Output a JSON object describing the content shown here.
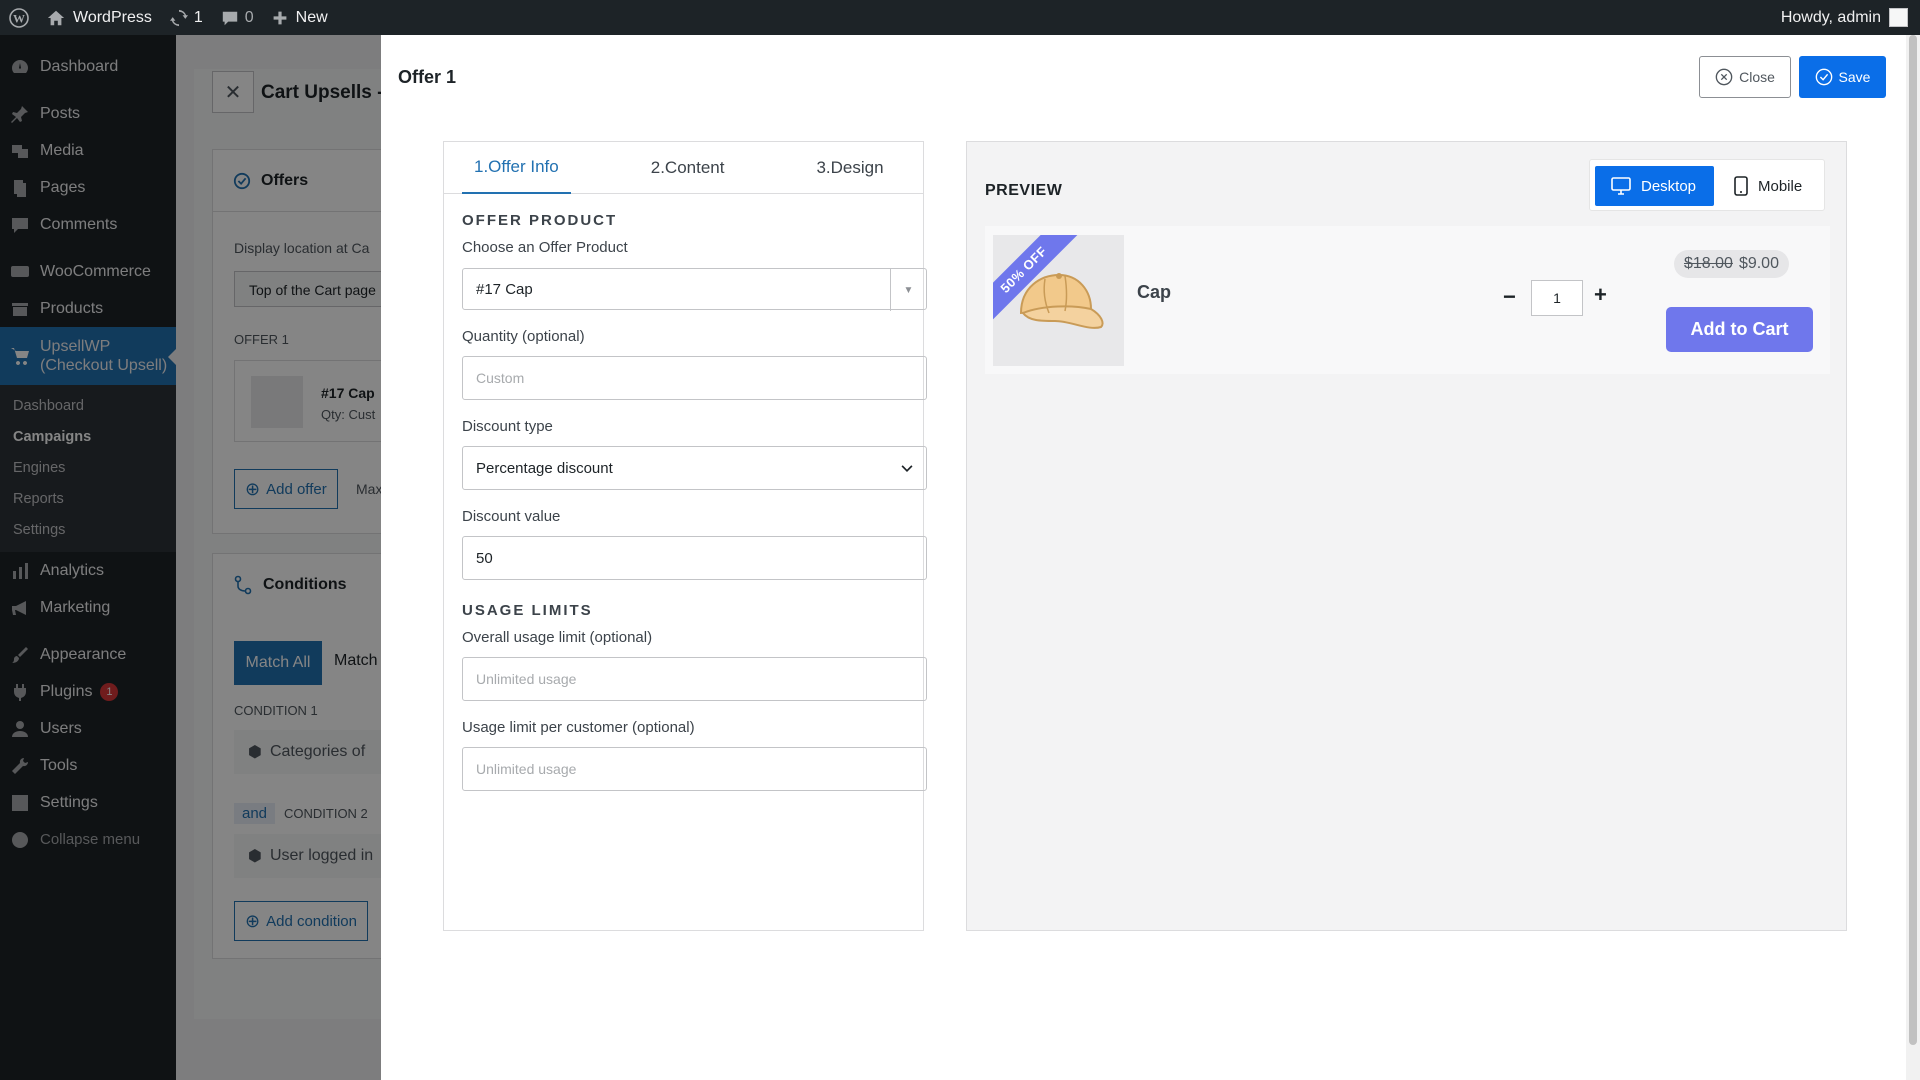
{
  "adminbar": {
    "site_name": "WordPress",
    "updates_count": "1",
    "comments_count": "0",
    "new_label": "New",
    "howdy": "Howdy, admin"
  },
  "sidebar": {
    "items": [
      {
        "label": "Dashboard",
        "icon": "dashboard-icon"
      },
      {
        "label": "Posts",
        "icon": "pin-icon"
      },
      {
        "label": "Media",
        "icon": "media-icon"
      },
      {
        "label": "Pages",
        "icon": "pages-icon"
      },
      {
        "label": "Comments",
        "icon": "comments-icon"
      },
      {
        "label": "WooCommerce",
        "icon": "woo-icon"
      },
      {
        "label": "Products",
        "icon": "products-icon"
      },
      {
        "label": "UpsellWP (Checkout Upsell)",
        "icon": "cart-icon"
      },
      {
        "label": "Analytics",
        "icon": "analytics-icon"
      },
      {
        "label": "Marketing",
        "icon": "megaphone-icon"
      },
      {
        "label": "Appearance",
        "icon": "brush-icon"
      },
      {
        "label": "Plugins",
        "icon": "plugin-icon",
        "badge": "1"
      },
      {
        "label": "Users",
        "icon": "users-icon"
      },
      {
        "label": "Tools",
        "icon": "wrench-icon"
      },
      {
        "label": "Settings",
        "icon": "settings-icon"
      },
      {
        "label": "Collapse menu",
        "icon": "collapse-icon"
      }
    ],
    "submenu": [
      "Dashboard",
      "Campaigns",
      "Engines",
      "Reports",
      "Settings"
    ]
  },
  "background": {
    "title": "Cart Upsells -",
    "offers_heading": "Offers",
    "display_location_label": "Display location at Ca",
    "display_location_value": "Top of the Cart page",
    "offer1_label": "OFFER 1",
    "offer1_name": "#17 Cap",
    "offer1_qty": "Qty: Cust",
    "add_offer": "Add offer",
    "max_label": "Max",
    "conditions_heading": "Conditions",
    "match_all": "Match All",
    "match_other": "Match",
    "condition1_label": "CONDITION 1",
    "condition1_value": "Categories of",
    "and_label": "and",
    "condition2_label": "CONDITION 2",
    "condition2_value": "User logged in",
    "add_condition": "Add condition"
  },
  "drawer": {
    "title": "Offer 1",
    "close_label": "Close",
    "save_label": "Save",
    "tabs": [
      "1.Offer Info",
      "2.Content",
      "3.Design"
    ],
    "offer_product_heading": "OFFER PRODUCT",
    "choose_product_label": "Choose an Offer Product",
    "choose_product_value": "#17 Cap",
    "quantity_label": "Quantity (optional)",
    "quantity_placeholder": "Custom",
    "discount_type_label": "Discount type",
    "discount_type_value": "Percentage discount",
    "discount_value_label": "Discount value",
    "discount_value": "50",
    "usage_limits_heading": "USAGE LIMITS",
    "overall_limit_label": "Overall usage limit (optional)",
    "overall_limit_placeholder": "Unlimited usage",
    "per_customer_label": "Usage limit per customer (optional)",
    "per_customer_placeholder": "Unlimited usage"
  },
  "preview": {
    "title": "PREVIEW",
    "desktop_label": "Desktop",
    "mobile_label": "Mobile",
    "ribbon": "50% OFF",
    "product_name": "Cap",
    "quantity": "1",
    "old_price": "$18.00",
    "new_price": "$9.00",
    "add_to_cart": "Add to Cart"
  },
  "colors": {
    "accent": "#0a6ee8",
    "wp_blue": "#2271b1",
    "preview_button": "#6f77ec",
    "admin_dark": "#1d2327"
  }
}
